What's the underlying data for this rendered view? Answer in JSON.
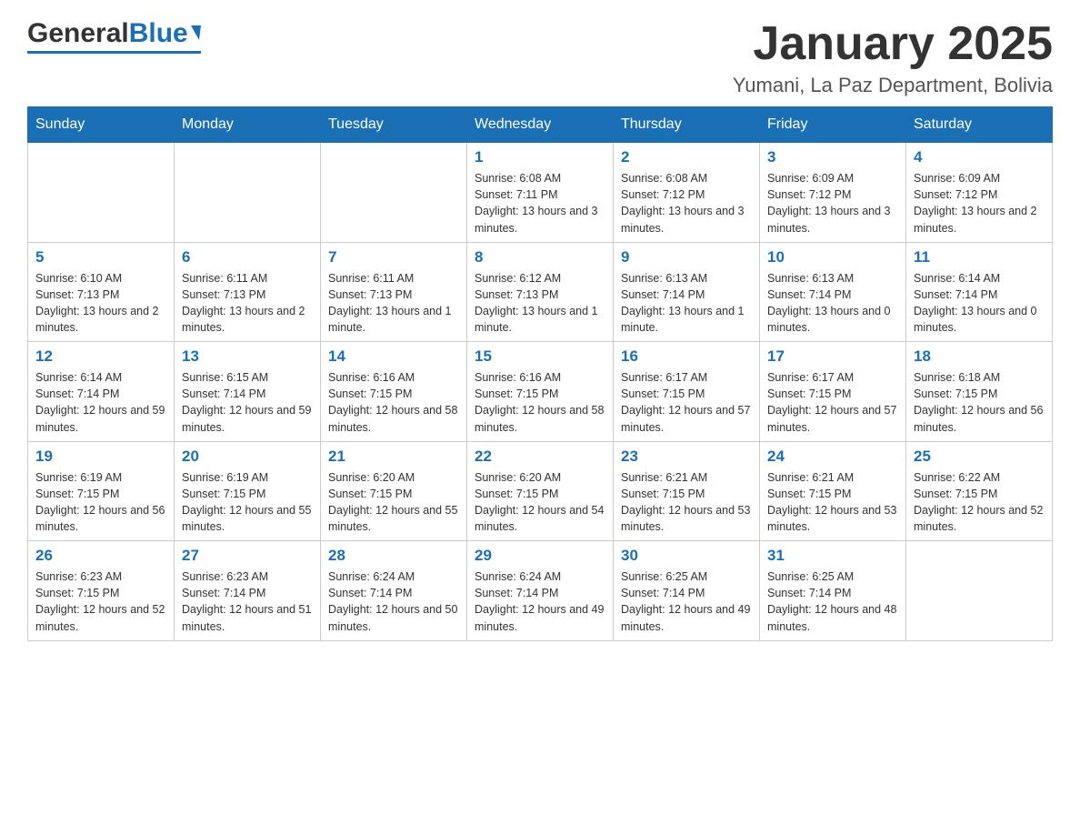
{
  "header": {
    "logo_general": "General",
    "logo_blue": "Blue",
    "month": "January 2025",
    "location": "Yumani, La Paz Department, Bolivia"
  },
  "days_of_week": [
    "Sunday",
    "Monday",
    "Tuesday",
    "Wednesday",
    "Thursday",
    "Friday",
    "Saturday"
  ],
  "weeks": [
    [
      {
        "day": "",
        "info": ""
      },
      {
        "day": "",
        "info": ""
      },
      {
        "day": "",
        "info": ""
      },
      {
        "day": "1",
        "info": "Sunrise: 6:08 AM\nSunset: 7:11 PM\nDaylight: 13 hours and 3 minutes."
      },
      {
        "day": "2",
        "info": "Sunrise: 6:08 AM\nSunset: 7:12 PM\nDaylight: 13 hours and 3 minutes."
      },
      {
        "day": "3",
        "info": "Sunrise: 6:09 AM\nSunset: 7:12 PM\nDaylight: 13 hours and 3 minutes."
      },
      {
        "day": "4",
        "info": "Sunrise: 6:09 AM\nSunset: 7:12 PM\nDaylight: 13 hours and 2 minutes."
      }
    ],
    [
      {
        "day": "5",
        "info": "Sunrise: 6:10 AM\nSunset: 7:13 PM\nDaylight: 13 hours and 2 minutes."
      },
      {
        "day": "6",
        "info": "Sunrise: 6:11 AM\nSunset: 7:13 PM\nDaylight: 13 hours and 2 minutes."
      },
      {
        "day": "7",
        "info": "Sunrise: 6:11 AM\nSunset: 7:13 PM\nDaylight: 13 hours and 1 minute."
      },
      {
        "day": "8",
        "info": "Sunrise: 6:12 AM\nSunset: 7:13 PM\nDaylight: 13 hours and 1 minute."
      },
      {
        "day": "9",
        "info": "Sunrise: 6:13 AM\nSunset: 7:14 PM\nDaylight: 13 hours and 1 minute."
      },
      {
        "day": "10",
        "info": "Sunrise: 6:13 AM\nSunset: 7:14 PM\nDaylight: 13 hours and 0 minutes."
      },
      {
        "day": "11",
        "info": "Sunrise: 6:14 AM\nSunset: 7:14 PM\nDaylight: 13 hours and 0 minutes."
      }
    ],
    [
      {
        "day": "12",
        "info": "Sunrise: 6:14 AM\nSunset: 7:14 PM\nDaylight: 12 hours and 59 minutes."
      },
      {
        "day": "13",
        "info": "Sunrise: 6:15 AM\nSunset: 7:14 PM\nDaylight: 12 hours and 59 minutes."
      },
      {
        "day": "14",
        "info": "Sunrise: 6:16 AM\nSunset: 7:15 PM\nDaylight: 12 hours and 58 minutes."
      },
      {
        "day": "15",
        "info": "Sunrise: 6:16 AM\nSunset: 7:15 PM\nDaylight: 12 hours and 58 minutes."
      },
      {
        "day": "16",
        "info": "Sunrise: 6:17 AM\nSunset: 7:15 PM\nDaylight: 12 hours and 57 minutes."
      },
      {
        "day": "17",
        "info": "Sunrise: 6:17 AM\nSunset: 7:15 PM\nDaylight: 12 hours and 57 minutes."
      },
      {
        "day": "18",
        "info": "Sunrise: 6:18 AM\nSunset: 7:15 PM\nDaylight: 12 hours and 56 minutes."
      }
    ],
    [
      {
        "day": "19",
        "info": "Sunrise: 6:19 AM\nSunset: 7:15 PM\nDaylight: 12 hours and 56 minutes."
      },
      {
        "day": "20",
        "info": "Sunrise: 6:19 AM\nSunset: 7:15 PM\nDaylight: 12 hours and 55 minutes."
      },
      {
        "day": "21",
        "info": "Sunrise: 6:20 AM\nSunset: 7:15 PM\nDaylight: 12 hours and 55 minutes."
      },
      {
        "day": "22",
        "info": "Sunrise: 6:20 AM\nSunset: 7:15 PM\nDaylight: 12 hours and 54 minutes."
      },
      {
        "day": "23",
        "info": "Sunrise: 6:21 AM\nSunset: 7:15 PM\nDaylight: 12 hours and 53 minutes."
      },
      {
        "day": "24",
        "info": "Sunrise: 6:21 AM\nSunset: 7:15 PM\nDaylight: 12 hours and 53 minutes."
      },
      {
        "day": "25",
        "info": "Sunrise: 6:22 AM\nSunset: 7:15 PM\nDaylight: 12 hours and 52 minutes."
      }
    ],
    [
      {
        "day": "26",
        "info": "Sunrise: 6:23 AM\nSunset: 7:15 PM\nDaylight: 12 hours and 52 minutes."
      },
      {
        "day": "27",
        "info": "Sunrise: 6:23 AM\nSunset: 7:14 PM\nDaylight: 12 hours and 51 minutes."
      },
      {
        "day": "28",
        "info": "Sunrise: 6:24 AM\nSunset: 7:14 PM\nDaylight: 12 hours and 50 minutes."
      },
      {
        "day": "29",
        "info": "Sunrise: 6:24 AM\nSunset: 7:14 PM\nDaylight: 12 hours and 49 minutes."
      },
      {
        "day": "30",
        "info": "Sunrise: 6:25 AM\nSunset: 7:14 PM\nDaylight: 12 hours and 49 minutes."
      },
      {
        "day": "31",
        "info": "Sunrise: 6:25 AM\nSunset: 7:14 PM\nDaylight: 12 hours and 48 minutes."
      },
      {
        "day": "",
        "info": ""
      }
    ]
  ]
}
